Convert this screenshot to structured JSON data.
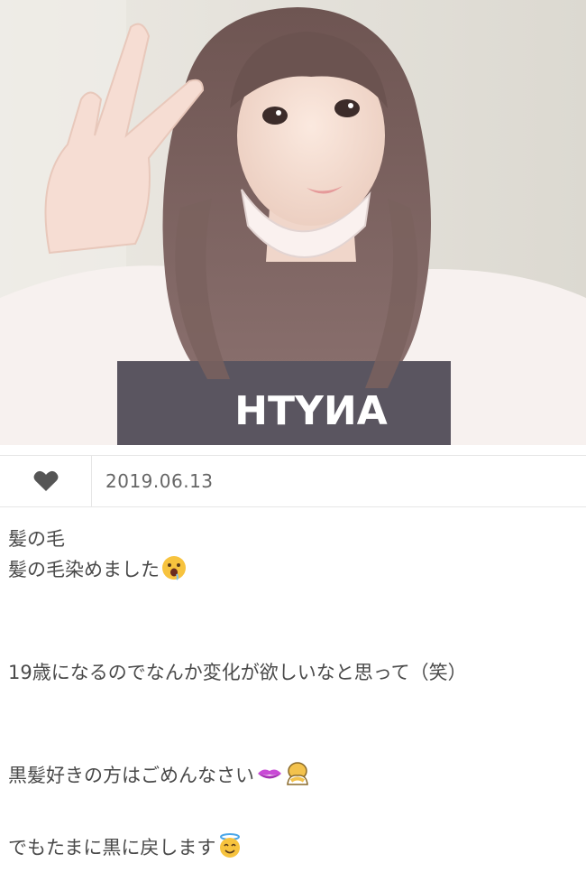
{
  "post": {
    "date": "2019.06.13",
    "title": "髪の毛",
    "lines": [
      "髪の毛染めました",
      "19歳になるのでなんか変化が欲しいなと思って（笑）",
      "黒髪好きの方はごめんなさい",
      "でもたまに黒に戻します"
    ]
  },
  "photo": {
    "shirt_text": "ANYTH"
  },
  "icons": {
    "like": "heart-icon",
    "emoji_1": "drooling-face-emoji",
    "emoji_2": "lips-emoji",
    "emoji_3": "person-bowing-emoji",
    "emoji_4": "smiling-face-with-halo-emoji"
  },
  "colors": {
    "heart": "#555555",
    "divider": "#e6e6e6",
    "text": "#4a4a4a",
    "date": "#666666"
  }
}
